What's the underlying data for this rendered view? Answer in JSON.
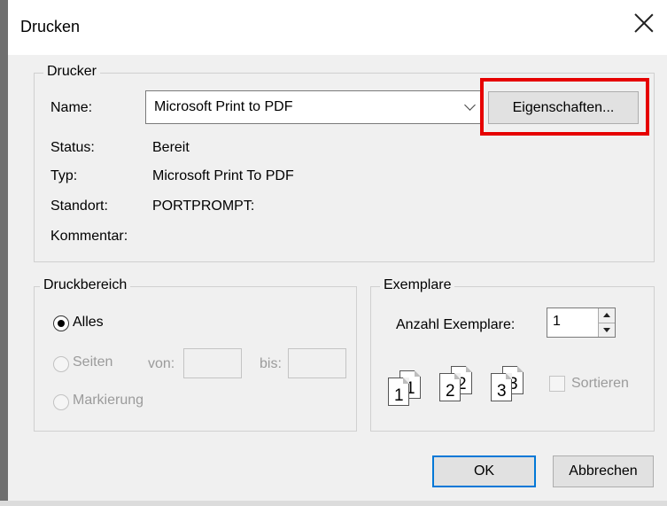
{
  "window": {
    "title": "Drucken"
  },
  "printer": {
    "group_label": "Drucker",
    "name_label": "Name:",
    "name_value": "Microsoft Print to PDF",
    "properties_button": "Eigenschaften...",
    "status_label": "Status:",
    "status_value": "Bereit",
    "type_label": "Typ:",
    "type_value": "Microsoft Print To PDF",
    "location_label": "Standort:",
    "location_value": "PORTPROMPT:",
    "comment_label": "Kommentar:"
  },
  "range": {
    "group_label": "Druckbereich",
    "all": "Alles",
    "pages": "Seiten",
    "from": "von:",
    "to": "bis:",
    "selection": "Markierung"
  },
  "copies": {
    "group_label": "Exemplare",
    "count_label": "Anzahl Exemplare:",
    "count_value": "1",
    "collate": "Sortieren",
    "page_numbers": [
      "1",
      "2",
      "3"
    ]
  },
  "buttons": {
    "ok": "OK",
    "cancel": "Abbrechen"
  },
  "colors": {
    "highlight": "#e60000",
    "primary_border": "#0078d7"
  }
}
